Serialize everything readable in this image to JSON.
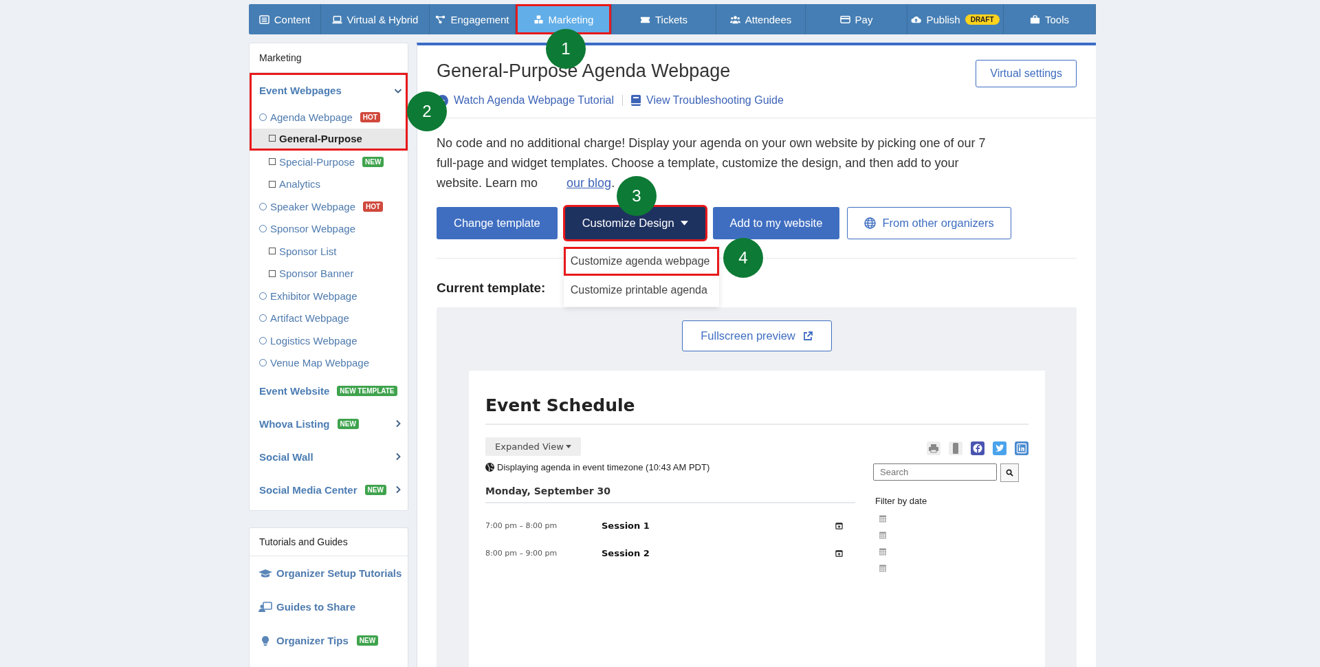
{
  "nav": {
    "tabs": [
      {
        "label": "Content",
        "selected": false,
        "highlighted": false
      },
      {
        "label": "Virtual & Hybrid",
        "selected": false,
        "highlighted": false
      },
      {
        "label": "Engagement",
        "selected": false,
        "highlighted": false
      },
      {
        "label": "Marketing",
        "selected": true,
        "highlighted": true
      },
      {
        "label": "Tickets",
        "selected": false,
        "highlighted": false
      },
      {
        "label": "Attendees",
        "selected": false,
        "highlighted": false
      },
      {
        "label": "Pay",
        "selected": false,
        "highlighted": false
      },
      {
        "label": "Publish",
        "selected": false,
        "highlighted": false,
        "badge": "DRAFT"
      },
      {
        "label": "Tools",
        "selected": false,
        "highlighted": false
      }
    ]
  },
  "sidebar": {
    "title": "Marketing",
    "sections": [
      {
        "label": "Event Webpages",
        "expanded": true,
        "highlighted": true,
        "children": [
          {
            "label": "Agenda Webpage",
            "highlighted": true,
            "badge": {
              "text": "HOT",
              "color": "#d0493d"
            },
            "children": [
              {
                "label": "General-Purpose",
                "selected": true,
                "highlighted": true
              },
              {
                "label": "Special-Purpose",
                "selected": false,
                "highlighted": false,
                "badge": {
                  "text": "NEW",
                  "color": "#3fa34d"
                }
              },
              {
                "label": "Analytics",
                "selected": false,
                "highlighted": false
              }
            ]
          },
          {
            "label": "Speaker Webpage",
            "highlighted": false,
            "badge": {
              "text": "HOT",
              "color": "#d0493d"
            }
          },
          {
            "label": "Sponsor Webpage",
            "highlighted": false,
            "children": [
              {
                "label": "Sponsor List",
                "selected": false,
                "highlighted": false
              },
              {
                "label": "Sponsor Banner",
                "selected": false,
                "highlighted": false
              }
            ]
          },
          {
            "label": "Exhibitor Webpage",
            "highlighted": false
          },
          {
            "label": "Artifact Webpage",
            "highlighted": false
          },
          {
            "label": "Logistics Webpage",
            "highlighted": false
          },
          {
            "label": "Venue Map Webpage",
            "highlighted": false
          }
        ]
      },
      {
        "label": "Event Website",
        "highlighted": false,
        "badge": {
          "text": "NEW TEMPLATE",
          "color": "#3fa34d"
        }
      },
      {
        "label": "Whova Listing",
        "expanded": false,
        "highlighted": false,
        "badge": {
          "text": "NEW",
          "color": "#3fa34d"
        }
      },
      {
        "label": "Social Wall",
        "expanded": false,
        "highlighted": false
      },
      {
        "label": "Social Media Center",
        "expanded": false,
        "highlighted": false,
        "badge": {
          "text": "NEW",
          "color": "#3fa34d"
        }
      }
    ]
  },
  "tutorials": {
    "title": "Tutorials and Guides",
    "items": [
      {
        "label": "Organizer Setup Tutorials"
      },
      {
        "label": "Guides to Share"
      },
      {
        "label": "Organizer Tips",
        "badge": {
          "text": "NEW",
          "color": "#3fa34d"
        }
      }
    ]
  },
  "main": {
    "title": "General-Purpose Agenda Webpage",
    "settings_button": "Virtual settings",
    "links": [
      "Watch Agenda Webpage Tutorial",
      "View Troubleshooting Guide"
    ],
    "description": "No code and no additional charge! Display your agenda on your own website by picking one of our 7 full-page and widget templates. Choose a template, customize the design, and then add to your website. Learn mo",
    "description_link": "our blog",
    "description_end": ".",
    "buttons": [
      {
        "label": "Change template",
        "kind": "primary",
        "highlighted": false
      },
      {
        "label": "Customize Design",
        "kind": "dropdown",
        "expanded": true,
        "highlighted": true
      },
      {
        "label": "Add to my website",
        "kind": "primary",
        "highlighted": false
      },
      {
        "label": "From other organizers",
        "kind": "outline",
        "highlighted": false
      }
    ],
    "dropdown": [
      {
        "label": "Customize agenda webpage",
        "highlighted": true
      },
      {
        "label": "Customize printable agenda",
        "highlighted": false
      }
    ],
    "current_template_label": "Current template:",
    "preview_button": "Fullscreen preview",
    "preview": {
      "title": "Event Schedule",
      "view_button": "Expanded View",
      "timezone": "Displaying agenda in event timezone (10:43 AM PDT)",
      "search": {
        "placeholder": "Search"
      },
      "day": "Monday, September 30",
      "sessions": [
        {
          "time": "7:00 pm – 8:00 pm",
          "name": "Session 1"
        },
        {
          "time": "8:00 pm – 9:00 pm",
          "name": "Session 2"
        }
      ],
      "filter_label": "Filter by date"
    }
  },
  "callouts": [
    "1",
    "2",
    "3",
    "4"
  ]
}
